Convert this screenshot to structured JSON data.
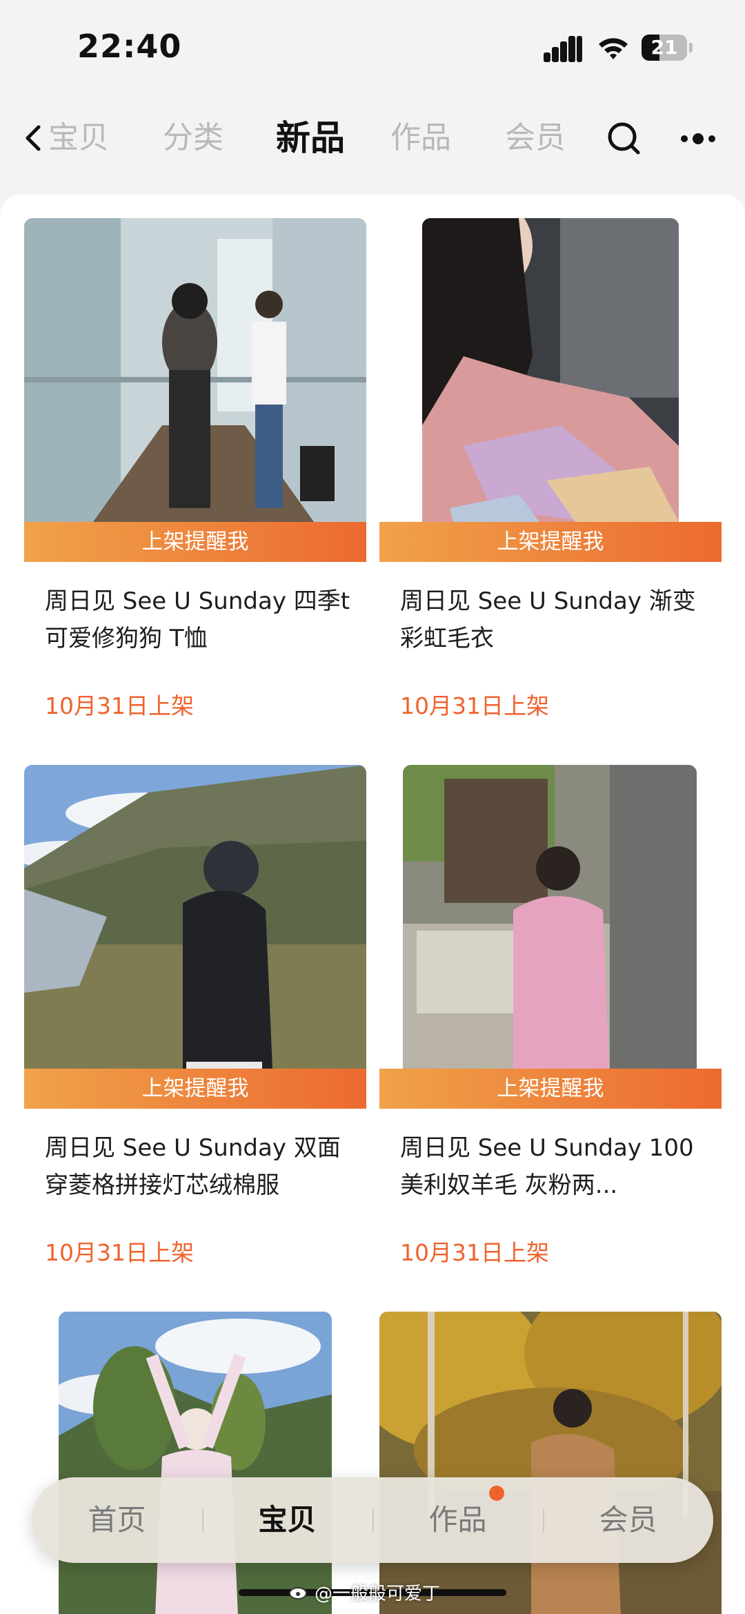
{
  "status": {
    "time": "22:40",
    "battery": "21"
  },
  "nav": {
    "tabs": [
      "宝贝",
      "分类",
      "新品",
      "作品",
      "会员"
    ],
    "active_tab": "新品"
  },
  "products": [
    {
      "title": "周日见 See U Sunday 四季t 可爱修狗狗 T恤",
      "date": "10月31日上架",
      "remind": "上架提醒我"
    },
    {
      "title": "周日见 See U Sunday 渐变彩虹毛衣",
      "date": "10月31日上架",
      "remind": "上架提醒我"
    },
    {
      "title": "周日见 See U Sunday 双面穿菱格拼接灯芯绒棉服",
      "date": "10月31日上架",
      "remind": "上架提醒我"
    },
    {
      "title": "周日见 See U Sunday 100美利奴羊毛 灰粉两...",
      "date": "10月31日上架",
      "remind": "上架提醒我"
    }
  ],
  "tabbar": {
    "items": [
      "首页",
      "宝贝",
      "作品",
      "会员"
    ],
    "active": "宝贝"
  },
  "watermark": "@一般般可爱丁",
  "colors": {
    "accent": "#f0622d",
    "remind_start": "#f0a24a",
    "remind_end": "#ec6a30"
  },
  "icons": [
    "back-chevron-icon",
    "search-icon",
    "more-icon",
    "signal-icon",
    "wifi-icon",
    "battery-icon",
    "weibo-icon"
  ]
}
